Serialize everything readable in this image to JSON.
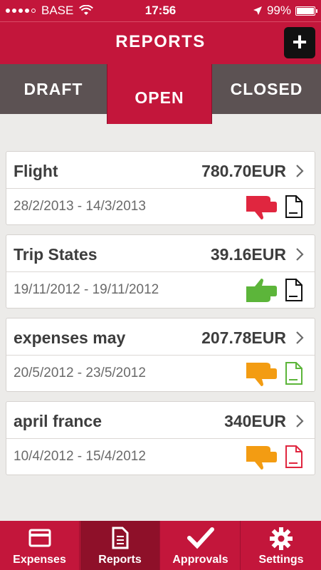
{
  "status_bar": {
    "carrier": "BASE",
    "time": "17:56",
    "battery": "99%",
    "signal_bars": 4,
    "signal_max": 5
  },
  "header": {
    "title": "REPORTS",
    "add_label": "+"
  },
  "tabs": [
    {
      "label": "DRAFT",
      "active": false
    },
    {
      "label": "OPEN",
      "active": true
    },
    {
      "label": "CLOSED",
      "active": false
    }
  ],
  "reports": [
    {
      "name": "Flight",
      "amount": "780.70EUR",
      "dates": "28/2/2013 - 14/3/2013",
      "status": "thumbs-down",
      "status_color": "#e0263f",
      "doc_color": "#111111"
    },
    {
      "name": "Trip States",
      "amount": "39.16EUR",
      "dates": "19/11/2012 - 19/11/2012",
      "status": "thumbs-up",
      "status_color": "#5cb53a",
      "doc_color": "#111111"
    },
    {
      "name": "expenses may",
      "amount": "207.78EUR",
      "dates": "20/5/2012 - 23/5/2012",
      "status": "thumbs-down",
      "status_color": "#f39c12",
      "doc_color": "#5cb53a"
    },
    {
      "name": "april france",
      "amount": "340EUR",
      "dates": "10/4/2012 - 15/4/2012",
      "status": "thumbs-down",
      "status_color": "#f39c12",
      "doc_color": "#e0263f"
    }
  ],
  "bottom_nav": [
    {
      "label": "Expenses",
      "icon": "card-icon",
      "active": false
    },
    {
      "label": "Reports",
      "icon": "document-icon",
      "active": true
    },
    {
      "label": "Approvals",
      "icon": "checkmark-icon",
      "active": false
    },
    {
      "label": "Settings",
      "icon": "gear-icon",
      "active": false
    }
  ],
  "colors": {
    "brand": "#c3163b",
    "tab_inactive": "#5c5253",
    "background": "#ecebe9"
  }
}
